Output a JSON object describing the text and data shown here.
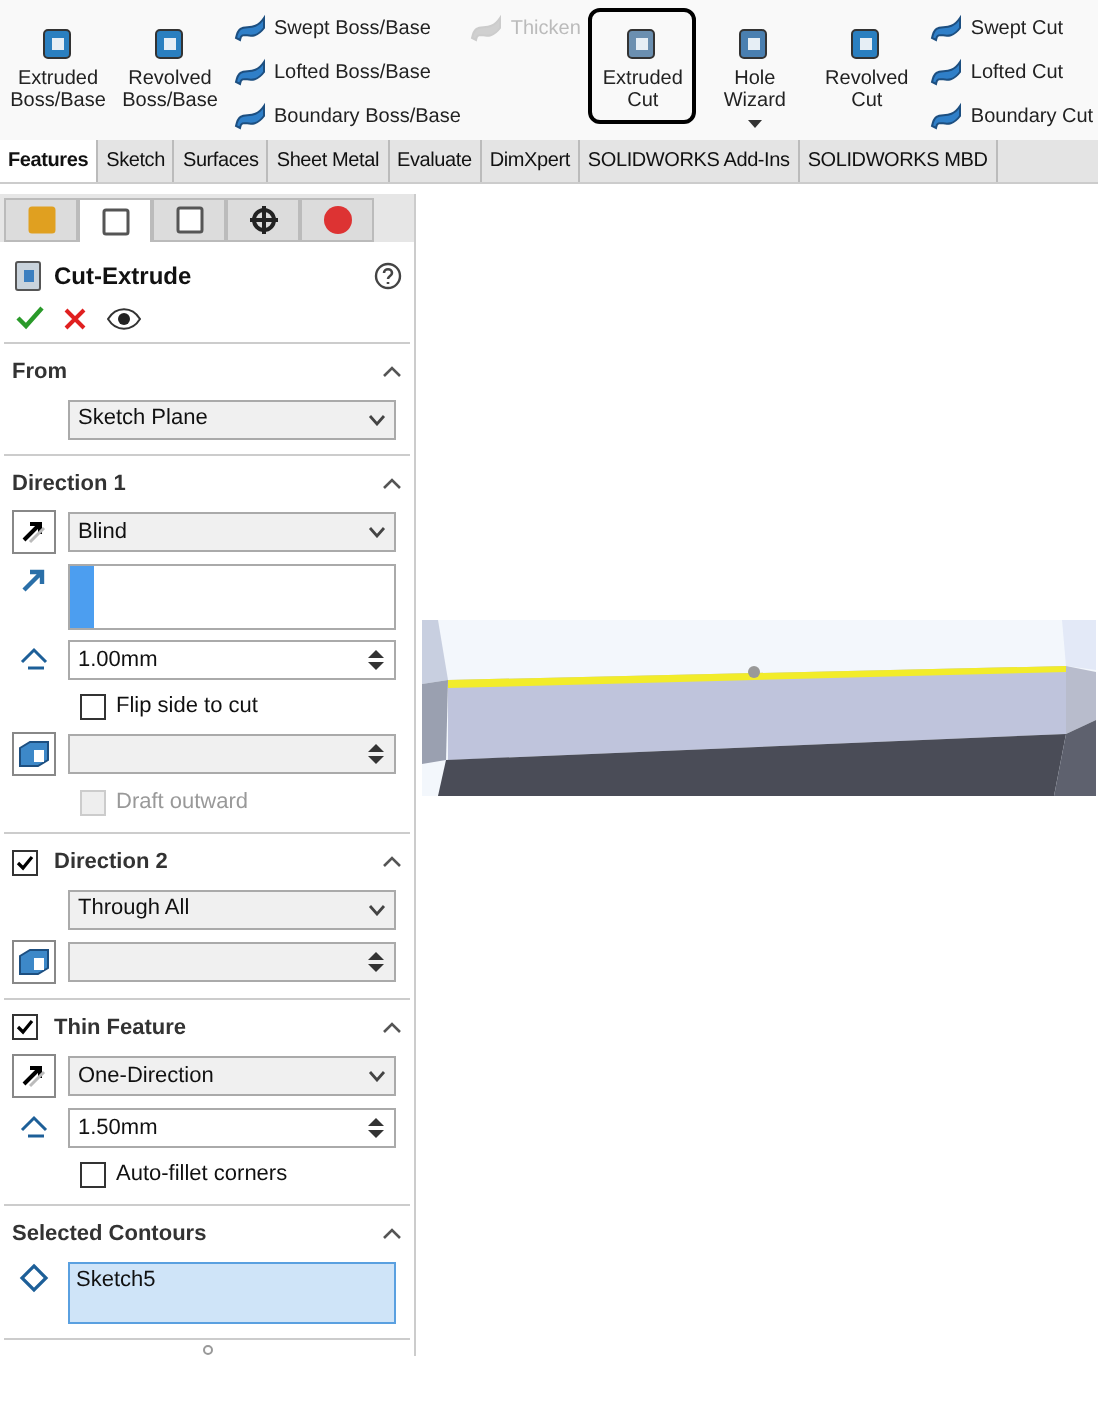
{
  "ribbon": {
    "groups": [
      {
        "kind": "large",
        "items": [
          {
            "label": "Extruded Boss/Base",
            "selected": false,
            "disabled": false,
            "dropdown": false
          },
          {
            "label": "Revolved Boss/Base",
            "selected": false,
            "disabled": false,
            "dropdown": false
          }
        ]
      },
      {
        "kind": "stack",
        "items": [
          {
            "label": "Swept Boss/Base",
            "disabled": false
          },
          {
            "label": "Lofted Boss/Base",
            "disabled": false
          },
          {
            "label": "Boundary Boss/Base",
            "disabled": false
          }
        ]
      },
      {
        "kind": "stack",
        "items": [
          {
            "label": "Thicken",
            "disabled": true
          }
        ]
      },
      {
        "kind": "large",
        "items": [
          {
            "label": "Extruded Cut",
            "selected": true,
            "disabled": false,
            "dropdown": false
          },
          {
            "label": "Hole Wizard",
            "selected": false,
            "disabled": false,
            "dropdown": true
          },
          {
            "label": "Revolved Cut",
            "selected": false,
            "disabled": false,
            "dropdown": false
          }
        ]
      },
      {
        "kind": "stack",
        "items": [
          {
            "label": "Swept Cut",
            "disabled": false
          },
          {
            "label": "Lofted Cut",
            "disabled": false
          },
          {
            "label": "Boundary Cut",
            "disabled": false
          }
        ]
      }
    ]
  },
  "tabs": [
    {
      "label": "Features",
      "selected": true
    },
    {
      "label": "Sketch",
      "selected": false
    },
    {
      "label": "Surfaces",
      "selected": false
    },
    {
      "label": "Sheet Metal",
      "selected": false
    },
    {
      "label": "Evaluate",
      "selected": false
    },
    {
      "label": "DimXpert",
      "selected": false
    },
    {
      "label": "SOLIDWORKS Add-Ins",
      "selected": false
    },
    {
      "label": "SOLIDWORKS MBD",
      "selected": false
    }
  ],
  "panel": {
    "tabs": [
      {
        "selected": false
      },
      {
        "selected": true
      },
      {
        "selected": false
      },
      {
        "selected": false
      },
      {
        "selected": false
      }
    ],
    "title": "Cut-Extrude",
    "sections": [
      {
        "title": "From",
        "rows": [
          {
            "kind": "dropdown",
            "value": "Sketch Plane"
          }
        ]
      },
      {
        "title": "Direction 1",
        "rows": [
          {
            "kind": "reverse-dropdown",
            "value": "Blind"
          },
          {
            "kind": "selection"
          },
          {
            "kind": "depth-spin",
            "value": "1.00mm"
          },
          {
            "kind": "checkbox",
            "label": "Flip side to cut",
            "checked": false,
            "disabled": false
          },
          {
            "kind": "draft-spin",
            "disabled": true
          },
          {
            "kind": "checkbox",
            "label": "Draft outward",
            "checked": false,
            "disabled": true
          }
        ]
      },
      {
        "title": "Direction 2",
        "checked": true,
        "rows": [
          {
            "kind": "dropdown",
            "value": "Through All"
          },
          {
            "kind": "draft-spin",
            "disabled": true
          }
        ]
      },
      {
        "title": "Thin Feature",
        "checked": true,
        "rows": [
          {
            "kind": "reverse-dropdown",
            "value": "One-Direction"
          },
          {
            "kind": "thickness-spin",
            "value": "1.50mm"
          },
          {
            "kind": "checkbox",
            "label": "Auto-fillet corners",
            "checked": false,
            "disabled": false
          }
        ]
      },
      {
        "title": "Selected Contours",
        "rows": [
          {
            "kind": "contour-list",
            "value": "Sketch5"
          }
        ]
      }
    ]
  }
}
